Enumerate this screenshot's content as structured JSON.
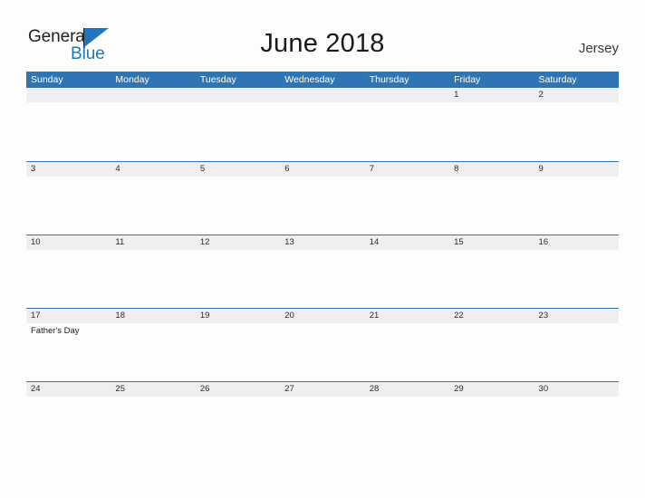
{
  "brand": {
    "name_part1": "General",
    "name_part2": "Blue",
    "logo_icon": "blue-triangle-flag"
  },
  "header": {
    "title": "June 2018",
    "region": "Jersey"
  },
  "colors": {
    "header_blue": "#2e75b6",
    "date_strip_gray": "#efefef",
    "logo_blue": "#1f76bc",
    "page_background": "#fdfdfd"
  },
  "calendar": {
    "weekdays": [
      "Sunday",
      "Monday",
      "Tuesday",
      "Wednesday",
      "Thursday",
      "Friday",
      "Saturday"
    ],
    "weeks": [
      {
        "days": [
          {
            "date": "",
            "event": ""
          },
          {
            "date": "",
            "event": ""
          },
          {
            "date": "",
            "event": ""
          },
          {
            "date": "",
            "event": ""
          },
          {
            "date": "",
            "event": ""
          },
          {
            "date": "1",
            "event": ""
          },
          {
            "date": "2",
            "event": ""
          }
        ]
      },
      {
        "days": [
          {
            "date": "3",
            "event": ""
          },
          {
            "date": "4",
            "event": ""
          },
          {
            "date": "5",
            "event": ""
          },
          {
            "date": "6",
            "event": ""
          },
          {
            "date": "7",
            "event": ""
          },
          {
            "date": "8",
            "event": ""
          },
          {
            "date": "9",
            "event": ""
          }
        ]
      },
      {
        "days": [
          {
            "date": "10",
            "event": ""
          },
          {
            "date": "11",
            "event": ""
          },
          {
            "date": "12",
            "event": ""
          },
          {
            "date": "13",
            "event": ""
          },
          {
            "date": "14",
            "event": ""
          },
          {
            "date": "15",
            "event": ""
          },
          {
            "date": "16",
            "event": ""
          }
        ]
      },
      {
        "days": [
          {
            "date": "17",
            "event": "Father's Day"
          },
          {
            "date": "18",
            "event": ""
          },
          {
            "date": "19",
            "event": ""
          },
          {
            "date": "20",
            "event": ""
          },
          {
            "date": "21",
            "event": ""
          },
          {
            "date": "22",
            "event": ""
          },
          {
            "date": "23",
            "event": ""
          }
        ]
      },
      {
        "days": [
          {
            "date": "24",
            "event": ""
          },
          {
            "date": "25",
            "event": ""
          },
          {
            "date": "26",
            "event": ""
          },
          {
            "date": "27",
            "event": ""
          },
          {
            "date": "28",
            "event": ""
          },
          {
            "date": "29",
            "event": ""
          },
          {
            "date": "30",
            "event": ""
          }
        ]
      }
    ]
  }
}
